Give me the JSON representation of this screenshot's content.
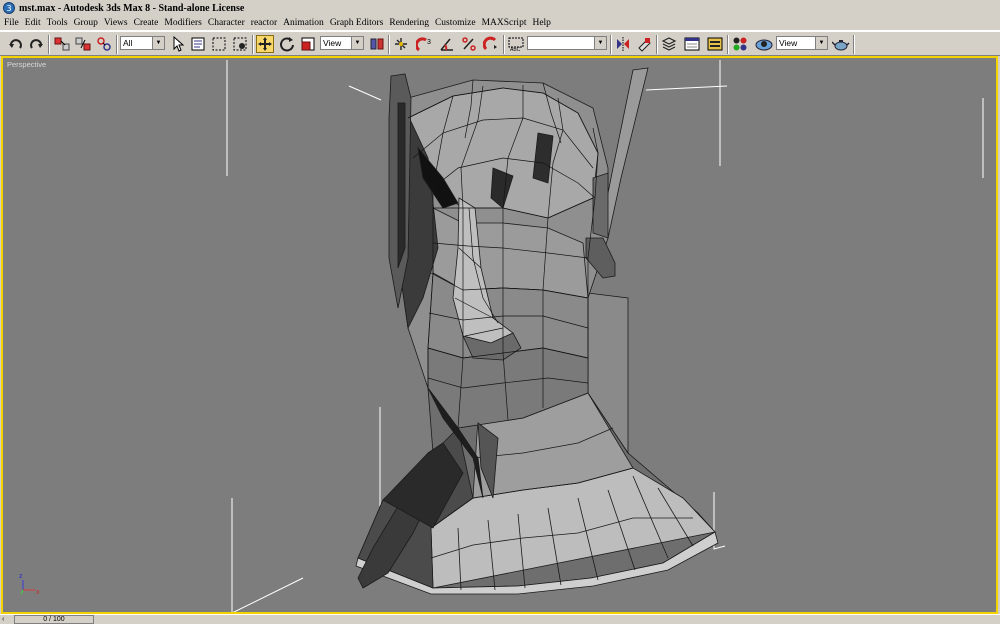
{
  "window": {
    "title": "mst.max - Autodesk 3ds Max 8  - Stand-alone License",
    "app_icon_glyph": "3"
  },
  "menu": {
    "items": [
      "File",
      "Edit",
      "Tools",
      "Group",
      "Views",
      "Create",
      "Modifiers",
      "Character",
      "reactor",
      "Animation",
      "Graph Editors",
      "Rendering",
      "Customize",
      "MAXScript",
      "Help"
    ]
  },
  "toolbar": {
    "selection_filter": "All",
    "reference_coord": "View",
    "named_selection": "",
    "render_type": "View",
    "active_tool": "select-and-move"
  },
  "viewport": {
    "label": "Perspective",
    "border_color": "#f2d200",
    "background": "#7d7d7d",
    "axis_labels": {
      "x": "x",
      "z": "z"
    }
  },
  "timeline": {
    "frame": "0 / 100"
  }
}
